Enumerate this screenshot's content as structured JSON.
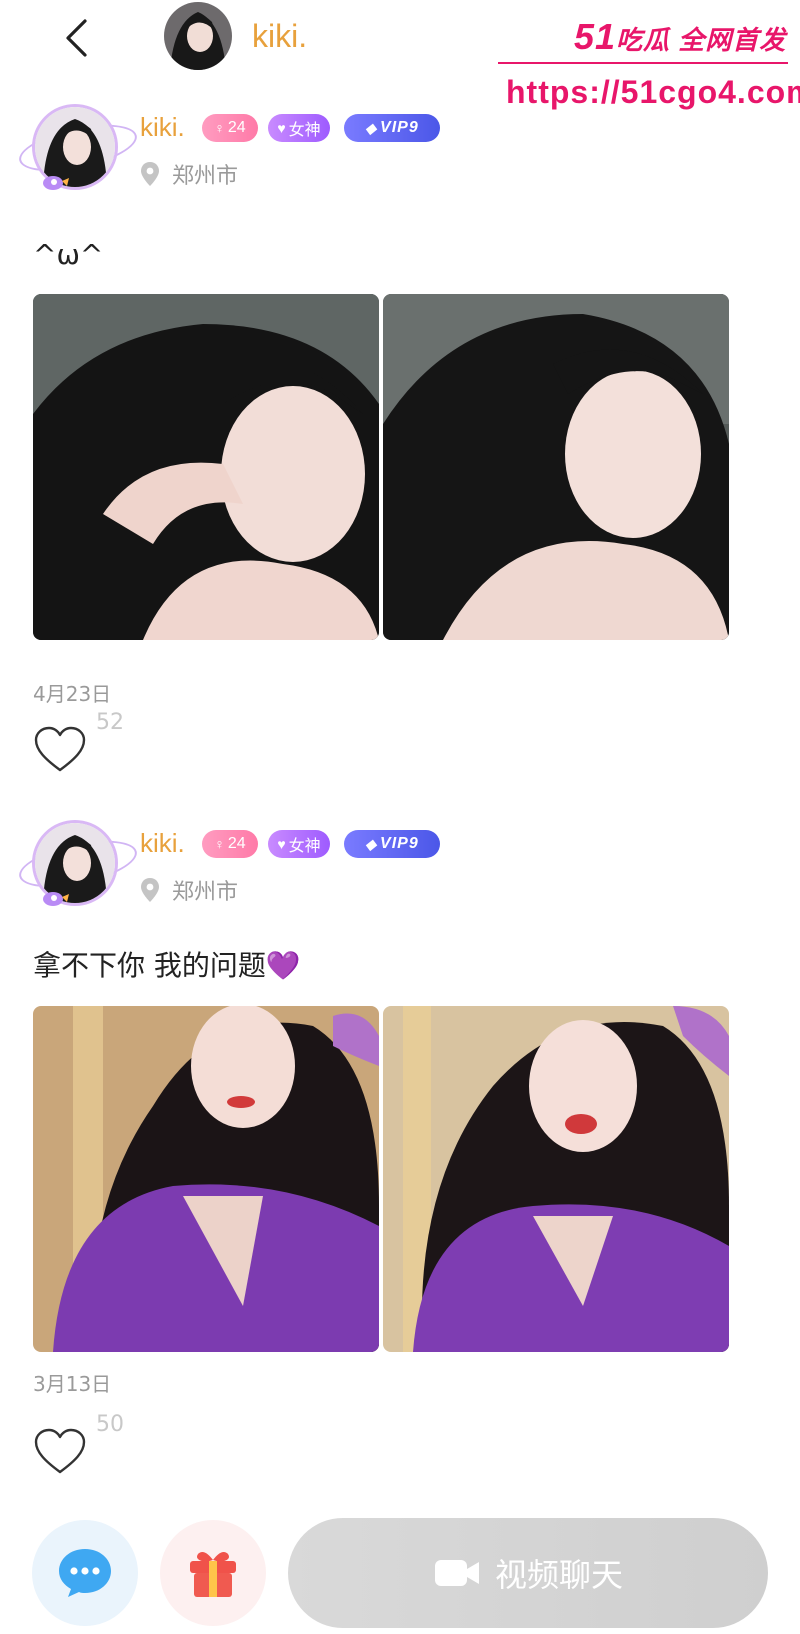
{
  "header": {
    "username": "kiki."
  },
  "watermark": {
    "brand_number": "51",
    "brand_text": "吃瓜 全网首发",
    "url": "https://51cgo4.com"
  },
  "posts": [
    {
      "username": "kiki.",
      "age": "24",
      "badge_goddess": "女神",
      "badge_vip": "VIP9",
      "location": "郑州市",
      "text": "^ω^",
      "date": "4月23日",
      "likes": "52"
    },
    {
      "username": "kiki.",
      "age": "24",
      "badge_goddess": "女神",
      "badge_vip": "VIP9",
      "location": "郑州市",
      "text": "拿不下你 我的问题💜",
      "date": "3月13日",
      "likes": "50"
    }
  ],
  "bottom_bar": {
    "video_chat_label": "视频聊天"
  },
  "colors": {
    "username": "#E8A13C",
    "watermark": "#E8166A",
    "age_badge": "#FF7AA8",
    "goddess_badge": "#9E5BFF",
    "vip_badge": "#4B57E8",
    "video_button": "#D4D4D4"
  },
  "icons": [
    "back-arrow-icon",
    "location-pin-icon",
    "heart-icon",
    "chat-bubble-icon",
    "gift-icon",
    "video-camera-icon"
  ]
}
